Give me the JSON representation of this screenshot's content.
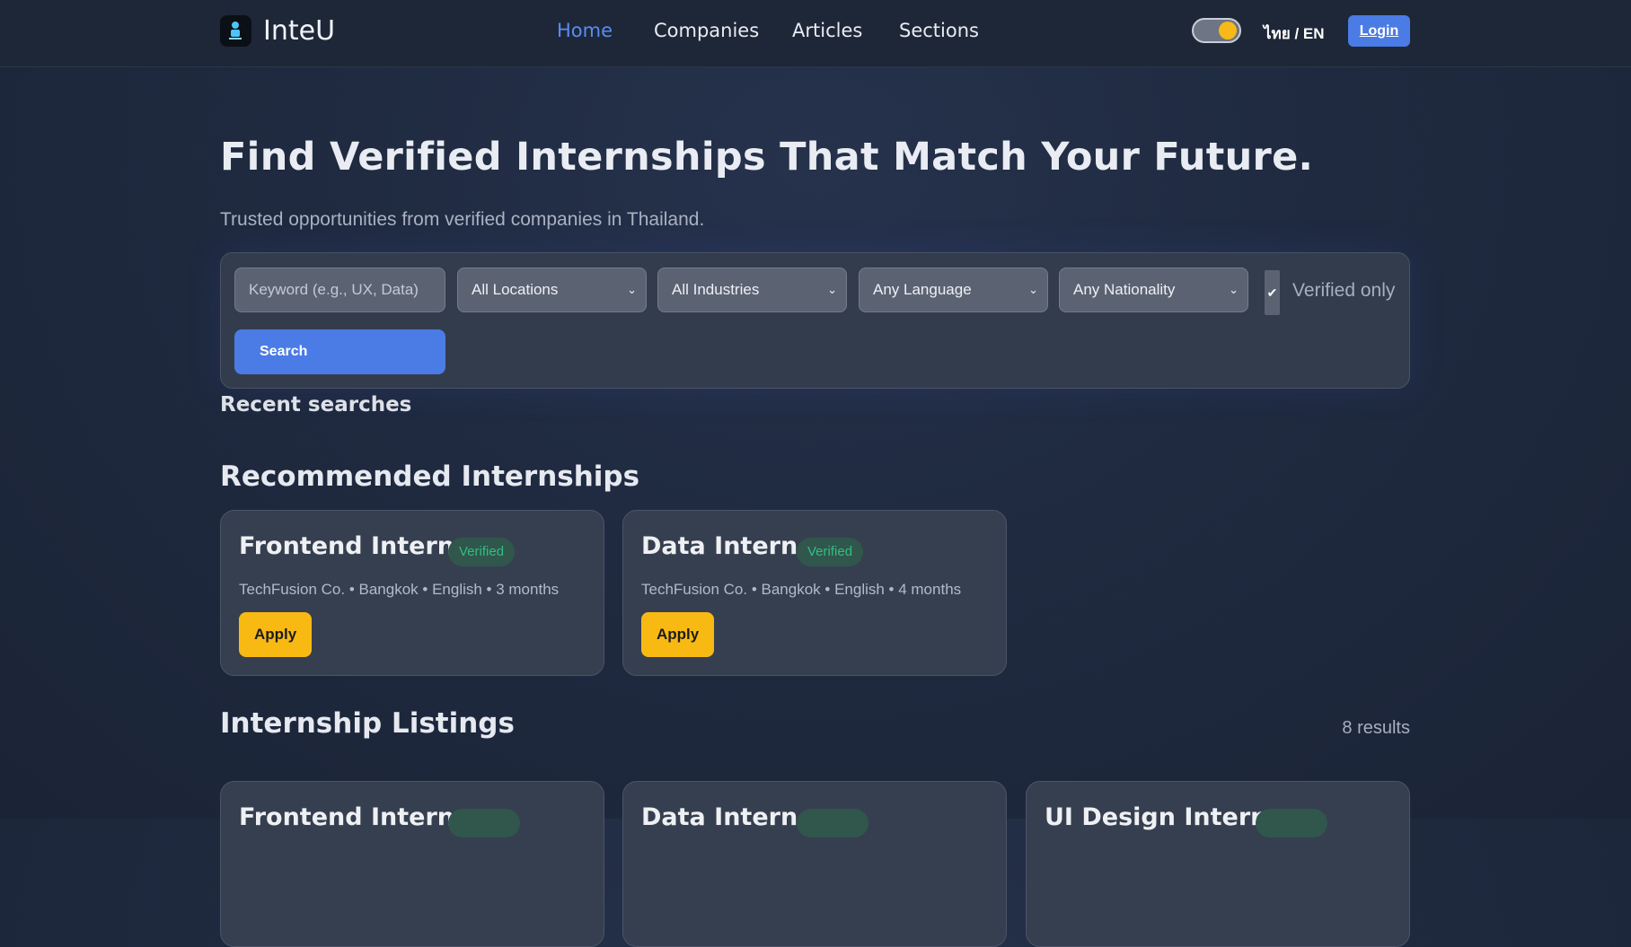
{
  "nav": {
    "brand": "InteU",
    "links": [
      "Home",
      "Companies",
      "Articles",
      "Sections"
    ],
    "active": "Home",
    "lang": "ไทย / EN",
    "login": "Login"
  },
  "hero": {
    "title": "Find Verified Internships That Match Your Future.",
    "subtitle": "Trusted opportunities from verified companies in Thailand."
  },
  "search": {
    "keyword_placeholder": "Keyword (e.g., UX, Data)",
    "location": "All Locations",
    "industry": "All Industries",
    "language": "Any Language",
    "nationality": "Any Nationality",
    "verified_only_label": "Verified only",
    "verified_only_checked": true,
    "button": "Search"
  },
  "recent_searches": {
    "title": "Recent searches"
  },
  "recommended": {
    "title": "Recommended Internships",
    "cards": [
      {
        "title": "Frontend Intern",
        "badge": "Verified",
        "meta": "TechFusion Co. • Bangkok • English • 3 months",
        "apply": "Apply"
      },
      {
        "title": "Data Intern",
        "badge": "Verified",
        "meta": "TechFusion Co. • Bangkok • English • 4 months",
        "apply": "Apply"
      }
    ]
  },
  "listings": {
    "title": "Internship Listings",
    "count": "8 results",
    "cards": [
      {
        "title": "Frontend Intern"
      },
      {
        "title": "Data Intern"
      },
      {
        "title": "UI Design Intern"
      }
    ]
  },
  "colors": {
    "accent": "#4b7be5",
    "apply": "#f8b913",
    "verified": "#2fbf85"
  }
}
